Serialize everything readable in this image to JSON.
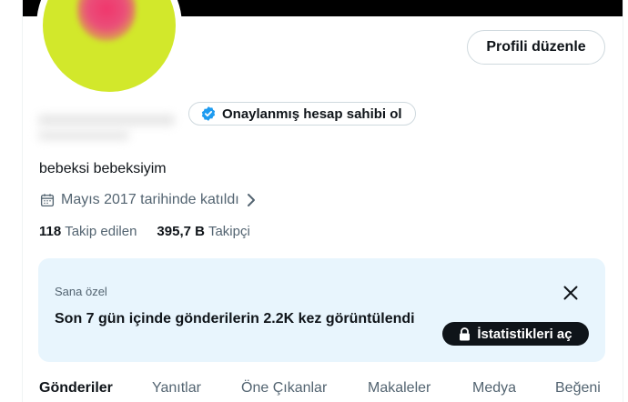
{
  "profile": {
    "edit_label": "Profili düzenle",
    "verify_label": "Onaylanmış hesap sahibi ol",
    "bio": "bebeksi bebeksiyim",
    "joined": "Mayıs 2017 tarihinde katıldı",
    "following_count": "118",
    "following_label": "Takip edilen",
    "followers_count": "395,7 B",
    "followers_label": "Takipçi"
  },
  "stats_card": {
    "label": "Sana özel",
    "text": "Son 7 gün içinde gönderilerin 2.2K kez görüntülendi",
    "button_label": "İstatistikleri aç"
  },
  "tabs": [
    {
      "label": "Gönderiler",
      "active": true
    },
    {
      "label": "Yanıtlar",
      "active": false
    },
    {
      "label": "Öne Çıkanlar",
      "active": false
    },
    {
      "label": "Makaleler",
      "active": false
    },
    {
      "label": "Medya",
      "active": false
    },
    {
      "label": "Beğeni",
      "active": false
    }
  ],
  "colors": {
    "accent_blue": "#1d9bf0",
    "card_bg": "#e8f5fd",
    "avatar_bg": "#d2e82b",
    "text_secondary": "#536471"
  },
  "icons": {
    "verified": "verified-badge-icon",
    "calendar": "calendar-icon",
    "chevron": "chevron-right-icon",
    "close": "close-icon",
    "lock": "lock-icon"
  }
}
